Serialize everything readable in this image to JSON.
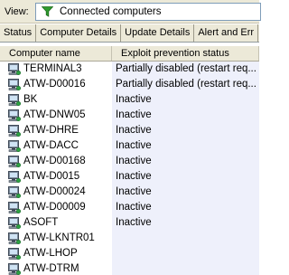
{
  "viewbar": {
    "label": "View:",
    "selected": "Connected computers"
  },
  "tabs": [
    {
      "label": "Status"
    },
    {
      "label": "Computer Details"
    },
    {
      "label": "Update Details"
    },
    {
      "label": "Alert and Err"
    }
  ],
  "grid": {
    "columns": [
      "Computer name",
      "Exploit prevention status"
    ],
    "rows": [
      {
        "name": "TERMINAL3",
        "status": "Partially disabled (restart req..."
      },
      {
        "name": "ATW-D00016",
        "status": "Partially disabled (restart req..."
      },
      {
        "name": "BK",
        "status": "Inactive"
      },
      {
        "name": "ATW-DNW05",
        "status": "Inactive"
      },
      {
        "name": "ATW-DHRE",
        "status": "Inactive"
      },
      {
        "name": "ATW-DACC",
        "status": "Inactive"
      },
      {
        "name": "ATW-D00168",
        "status": "Inactive"
      },
      {
        "name": "ATW-D0015",
        "status": "Inactive"
      },
      {
        "name": "ATW-D00024",
        "status": "Inactive"
      },
      {
        "name": "ATW-D00009",
        "status": "Inactive"
      },
      {
        "name": "ASOFT",
        "status": "Inactive"
      },
      {
        "name": "ATW-LKNTR01",
        "status": ""
      },
      {
        "name": "ATW-LHOP",
        "status": ""
      },
      {
        "name": "ATW-DTRM",
        "status": ""
      }
    ]
  },
  "colors": {
    "funnel": "#2e9b2e",
    "status_column_bg": "#eef0fb",
    "chrome": "#ece9d8"
  },
  "icons": {
    "filter": "funnel-icon",
    "computer": "computer-icon"
  }
}
